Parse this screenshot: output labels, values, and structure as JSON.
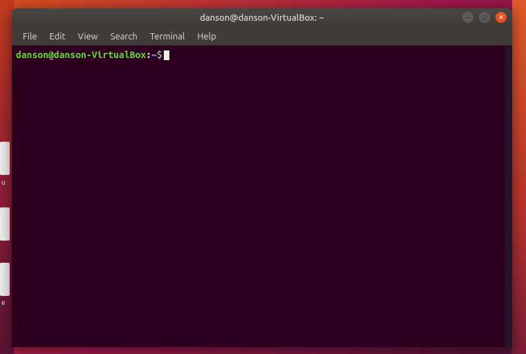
{
  "window": {
    "title": "danson@danson-VirtualBox: ~"
  },
  "window_controls": {
    "minimize_icon": "—",
    "maximize_icon": "◻",
    "close_icon": "✕"
  },
  "menu": {
    "items": [
      "File",
      "Edit",
      "View",
      "Search",
      "Terminal",
      "Help"
    ]
  },
  "terminal": {
    "prompt_user_host": "danson@danson-VirtualBox",
    "prompt_separator": ":",
    "prompt_path": "~",
    "prompt_symbol": "$",
    "input": ""
  },
  "desktop": {
    "partial_labels": [
      "u",
      "",
      "e"
    ]
  }
}
